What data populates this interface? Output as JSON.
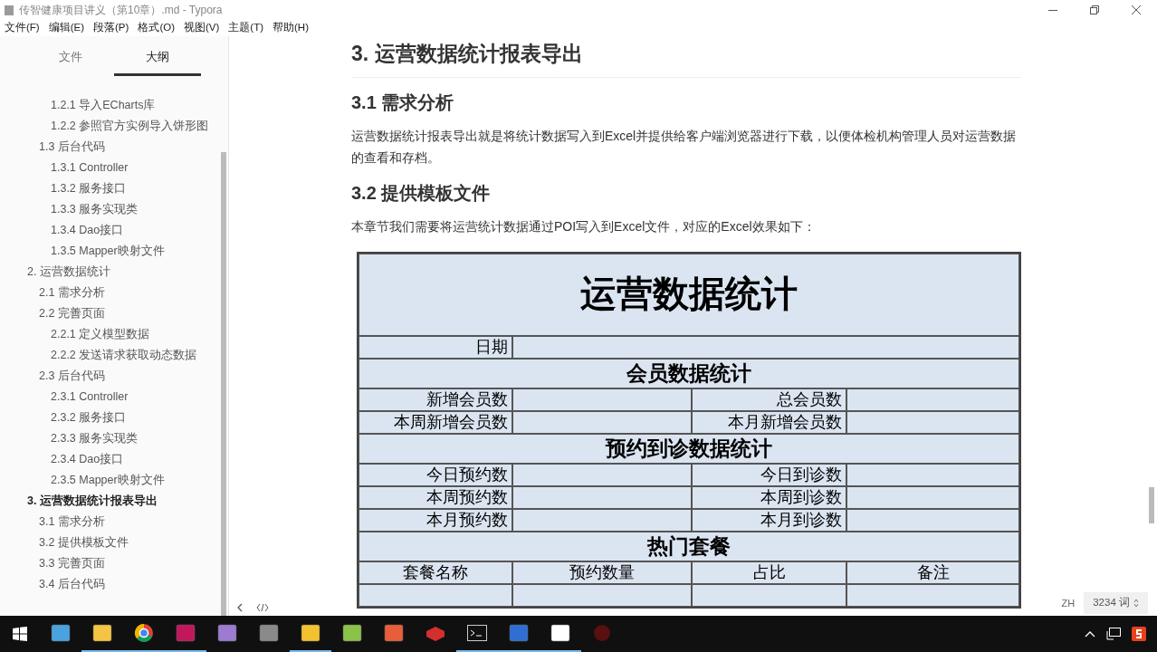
{
  "window": {
    "title": "传智健康项目讲义（第10章）.md - Typora"
  },
  "menu": [
    "文件(F)",
    "编辑(E)",
    "段落(P)",
    "格式(O)",
    "视图(V)",
    "主题(T)",
    "帮助(H)"
  ],
  "sidebar_tabs": [
    {
      "label": "文件",
      "selected": false
    },
    {
      "label": "大纲",
      "selected": true
    }
  ],
  "outline": [
    {
      "children": [
        {
          "children": [
            {
              "title": "1.2.1 导入ECharts库",
              "current": false
            },
            {
              "title": "1.2.2 参照官方实例导入饼形图",
              "current": false
            }
          ]
        },
        {
          "title": "1.3 后台代码",
          "current": false,
          "children": [
            {
              "title": "1.3.1 Controller",
              "current": false
            },
            {
              "title": "1.3.2 服务接口",
              "current": false
            },
            {
              "title": "1.3.3 服务实现类",
              "current": false
            },
            {
              "title": "1.3.4 Dao接口",
              "current": false
            },
            {
              "title": "1.3.5 Mapper映射文件",
              "current": false
            }
          ]
        }
      ]
    },
    {
      "title": "2. 运营数据统计",
      "current": false,
      "children": [
        {
          "title": "2.1 需求分析",
          "current": false
        },
        {
          "title": "2.2 完善页面",
          "current": false,
          "children": [
            {
              "title": "2.2.1 定义模型数据",
              "current": false
            },
            {
              "title": "2.2.2 发送请求获取动态数据",
              "current": false
            }
          ]
        },
        {
          "title": "2.3 后台代码",
          "current": false,
          "children": [
            {
              "title": "2.3.1 Controller",
              "current": false
            },
            {
              "title": "2.3.2 服务接口",
              "current": false
            },
            {
              "title": "2.3.3 服务实现类",
              "current": false
            },
            {
              "title": "2.3.4 Dao接口",
              "current": false
            },
            {
              "title": "2.3.5 Mapper映射文件",
              "current": false
            }
          ]
        }
      ]
    },
    {
      "title": "3. 运营数据统计报表导出",
      "current": true,
      "children": [
        {
          "title": "3.1 需求分析",
          "current": false
        },
        {
          "title": "3.2 提供模板文件",
          "current": false
        },
        {
          "title": "3.3 完善页面",
          "current": false
        },
        {
          "title": "3.4 后台代码",
          "current": false
        }
      ]
    }
  ],
  "document": [
    {
      "kind": "h2",
      "text": "3. 运营数据统计报表导出"
    },
    {
      "kind": "h3",
      "text": "3.1 需求分析"
    },
    {
      "kind": "p",
      "text": "运营数据统计报表导出就是将统计数据写入到Excel并提供给客户端浏览器进行下载，以便体检机构管理人员对运营数据的查看和存档。"
    },
    {
      "kind": "h3",
      "text": "3.2 提供模板文件"
    },
    {
      "kind": "p",
      "text": "本章节我们需要将运营统计数据通过POI写入到Excel文件，对应的Excel效果如下："
    }
  ],
  "sheet": {
    "title": "运营数据统计",
    "rows": [
      {
        "kind": "label",
        "cells": [
          "日期"
        ]
      },
      {
        "kind": "section",
        "cells": [
          "会员数据统计"
        ]
      },
      {
        "kind": "pair",
        "cells": [
          "新增会员数",
          "总会员数"
        ]
      },
      {
        "kind": "pair",
        "cells": [
          "本周新增会员数",
          "本月新增会员数"
        ]
      },
      {
        "kind": "section",
        "cells": [
          "预约到诊数据统计"
        ]
      },
      {
        "kind": "pair",
        "cells": [
          "今日预约数",
          "今日到诊数"
        ]
      },
      {
        "kind": "pair",
        "cells": [
          "本周预约数",
          "本周到诊数"
        ]
      },
      {
        "kind": "pair",
        "cells": [
          "本月预约数",
          "本月到诊数"
        ]
      },
      {
        "kind": "section",
        "cells": [
          "热门套餐"
        ]
      },
      {
        "kind": "header",
        "cells": [
          "套餐名称",
          "预约数量",
          "占比",
          "备注"
        ]
      },
      {
        "kind": "blank",
        "cells": []
      }
    ]
  },
  "status": {
    "language": "ZH",
    "word_count": "3234 词"
  },
  "taskbar": [
    {
      "running": false
    },
    {
      "running": true
    },
    {
      "running": true
    },
    {
      "running": true
    },
    {
      "running": false
    },
    {
      "running": false
    },
    {
      "running": true
    },
    {
      "running": false
    },
    {
      "running": false
    },
    {
      "running": false
    },
    {
      "running": true
    },
    {
      "running": true
    },
    {
      "running": true
    },
    {
      "running": false
    }
  ]
}
